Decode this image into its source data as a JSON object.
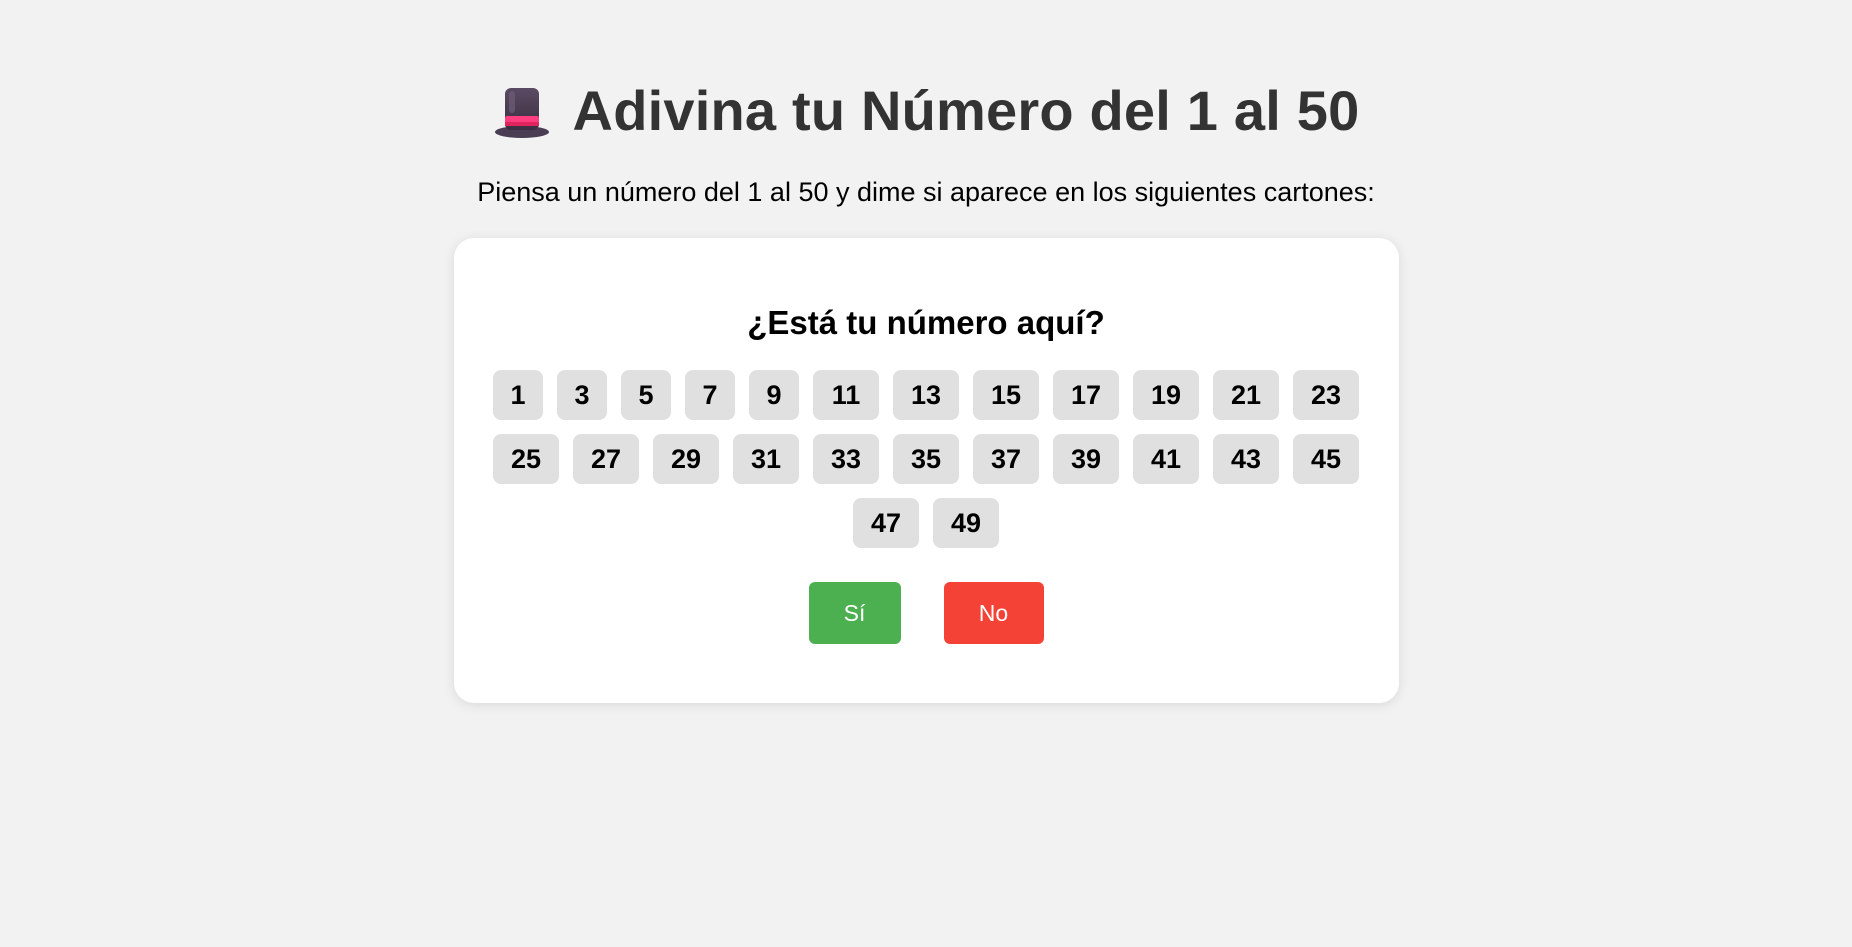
{
  "header": {
    "icon": "top-hat-icon",
    "title": "Adivina tu Número del 1 al 50",
    "subtitle": "Piensa un número del 1 al 50 y dime si aparece en los siguientes cartones:"
  },
  "card": {
    "question": "¿Está tu número aquí?",
    "numbers": [
      "1",
      "3",
      "5",
      "7",
      "9",
      "11",
      "13",
      "15",
      "17",
      "19",
      "21",
      "23",
      "25",
      "27",
      "29",
      "31",
      "33",
      "35",
      "37",
      "39",
      "41",
      "43",
      "45",
      "47",
      "49"
    ],
    "yes_label": "Sí",
    "no_label": "No"
  },
  "colors": {
    "background": "#f2f2f2",
    "yes": "#4caf50",
    "no": "#f44336",
    "number_tile": "#e0e0e0",
    "title": "#333333"
  }
}
